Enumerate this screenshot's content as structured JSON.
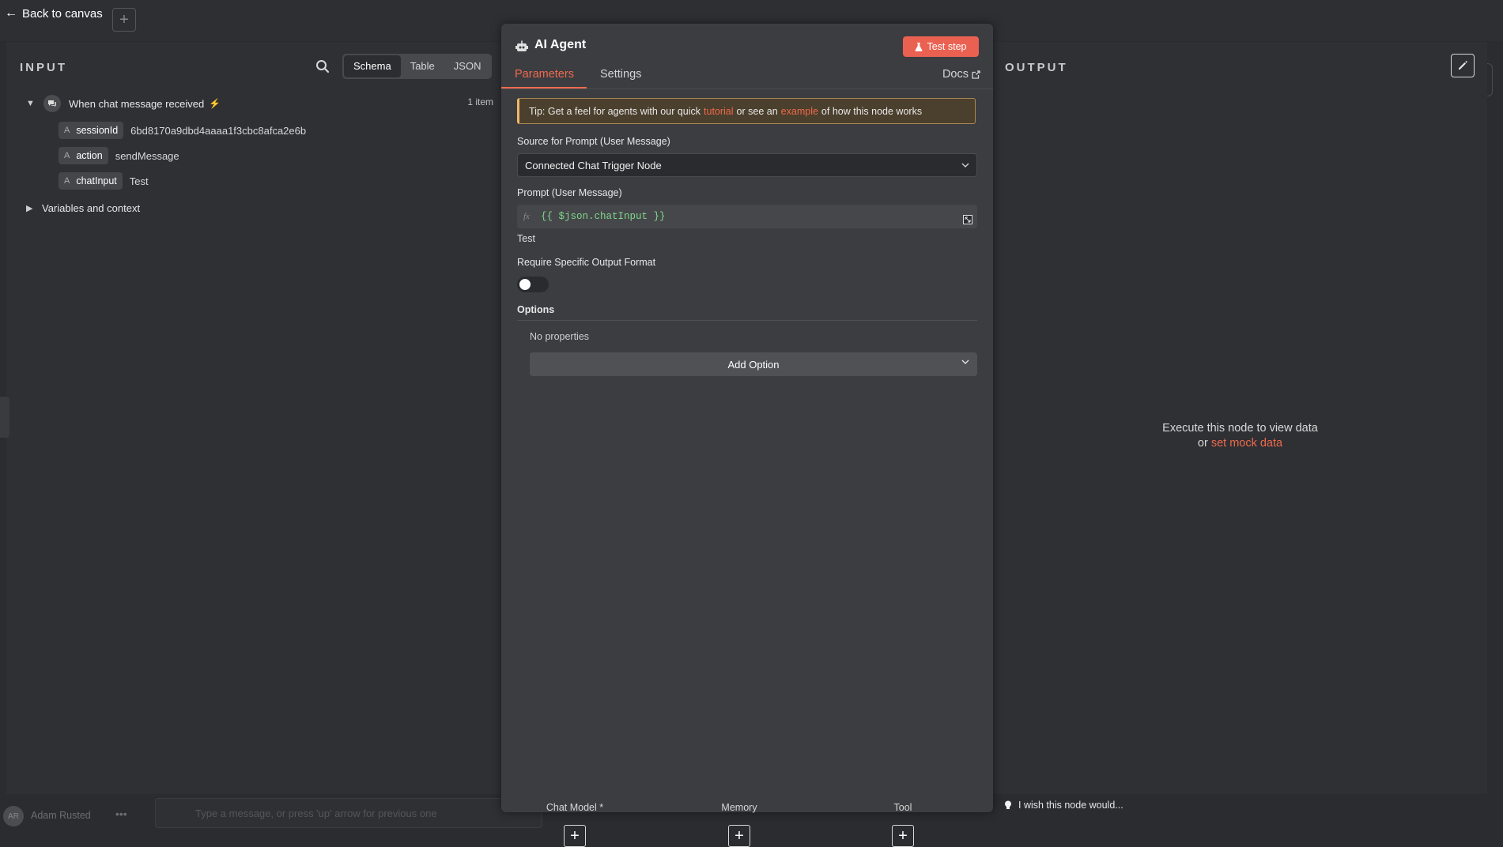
{
  "topbar": {
    "back_label": "Back to canvas"
  },
  "input": {
    "heading": "INPUT",
    "views": [
      "Schema",
      "Table",
      "JSON"
    ],
    "active_view": "Schema",
    "trigger_name": "When chat message received",
    "item_count": "1 item",
    "fields": [
      {
        "type": "A",
        "key": "sessionId",
        "value": "6bd8170a9dbd4aaaa1f3cbc8afca2e6b"
      },
      {
        "type": "A",
        "key": "action",
        "value": "sendMessage"
      },
      {
        "type": "A",
        "key": "chatInput",
        "value": "Test"
      }
    ],
    "variables_label": "Variables and context"
  },
  "node": {
    "title": "AI Agent",
    "test_step_label": "Test step",
    "tabs": {
      "parameters": "Parameters",
      "settings": "Settings",
      "docs": "Docs"
    },
    "tip": {
      "part1": "Tip: Get a feel for agents with our quick",
      "link1": "tutorial",
      "part2": "or see an",
      "link2": "example",
      "part3": "of how this node works"
    },
    "source_label": "Source for Prompt (User Message)",
    "source_value": "Connected Chat Trigger Node",
    "prompt_label": "Prompt (User Message)",
    "prompt_fx": "fx",
    "prompt_expression": "{{ $json.chatInput }}",
    "prompt_preview": "Test",
    "output_format_label": "Require Specific Output Format",
    "output_format_enabled": false,
    "options_label": "Options",
    "no_properties": "No properties",
    "add_option_label": "Add Option",
    "subnodes": [
      {
        "label": "Chat Model *"
      },
      {
        "label": "Memory"
      },
      {
        "label": "Tool"
      }
    ]
  },
  "output": {
    "heading": "OUTPUT",
    "empty_line1": "Execute this node to view data",
    "empty_or": "or",
    "mock_link": "set mock data"
  },
  "bottom": {
    "avatar_initials": "AR",
    "user_name": "Adam Rusted",
    "menu_dots": "•••",
    "chat_placeholder": "Type a message, or press 'up' arrow for previous one",
    "feedback_label": "I wish this node would..."
  },
  "colors": {
    "accent": "#ef6a4c",
    "test_step_bg": "#ea6152",
    "expression_green": "#7fd88a",
    "tip_bg": "#4b3f2d"
  }
}
